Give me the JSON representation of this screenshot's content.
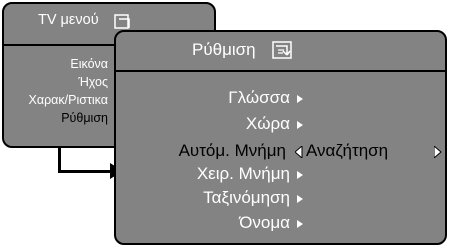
{
  "back_menu": {
    "title": "TV μενού",
    "items": [
      {
        "label": "Εικόνα",
        "selected": false
      },
      {
        "label": "Ήχος",
        "selected": false
      },
      {
        "label": "Χαρακ/Ριστικα",
        "selected": false
      },
      {
        "label": "Ρύθμιση",
        "selected": true
      }
    ]
  },
  "front_menu": {
    "title": "Ρύθμιση",
    "items": [
      {
        "label": "Γλώσσα",
        "selected": false
      },
      {
        "label": "Χώρα",
        "selected": false
      },
      {
        "label": "Αυτόμ. Μνήμη",
        "selected": true
      },
      {
        "label": "Χειρ. Μνήμη",
        "selected": false
      },
      {
        "label": "Ταξινόμηση",
        "selected": false
      },
      {
        "label": "Όνομα",
        "selected": false
      }
    ],
    "option_value": "Αναζήτηση"
  },
  "colors": {
    "panel": "#838383",
    "border": "#000000",
    "text": "#ffffff",
    "selected_text": "#000000"
  },
  "icons": [
    "menu-icon",
    "setup-icon",
    "arrow-right-icon",
    "cycle-left-icon",
    "cycle-right-icon",
    "submenu-arrow-icon"
  ]
}
